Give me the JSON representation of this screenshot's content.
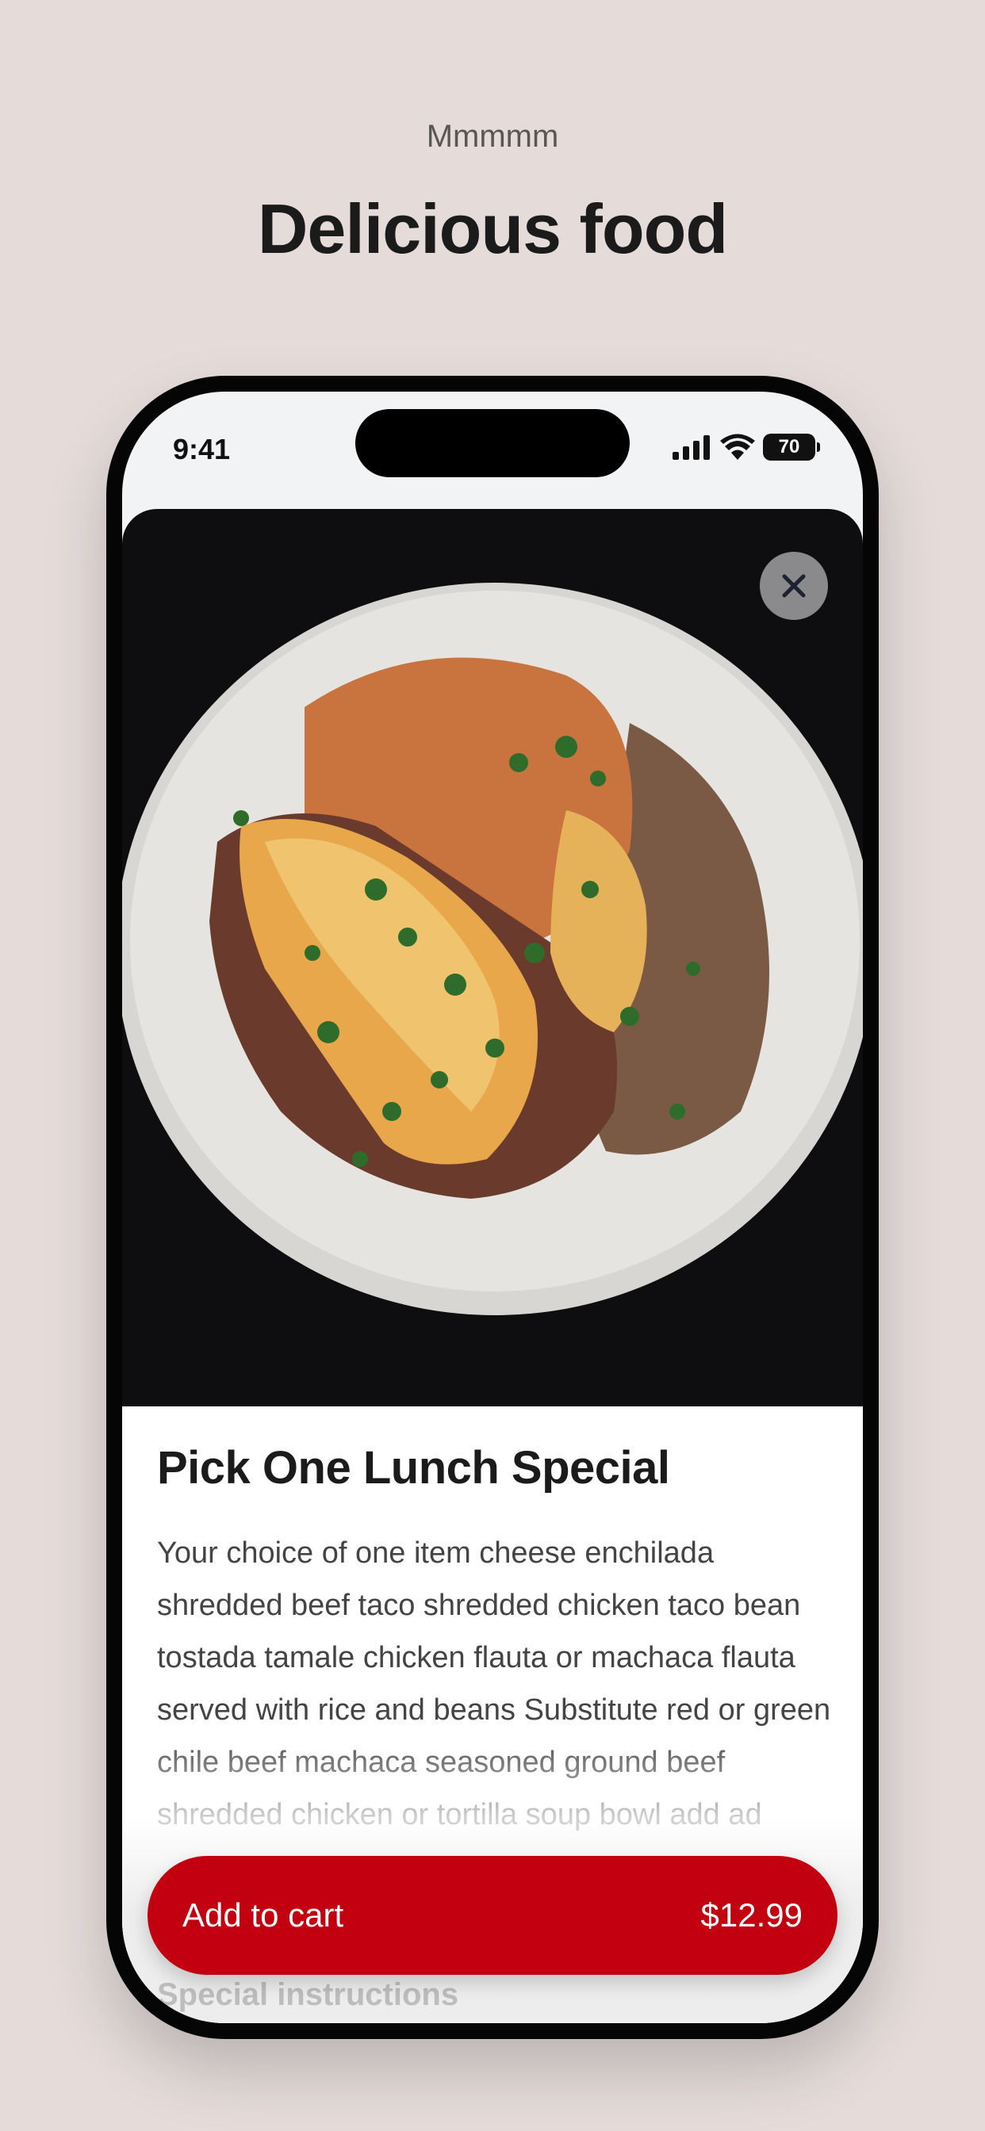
{
  "page": {
    "eyebrow": "Mmmmm",
    "headline": "Delicious food"
  },
  "status_bar": {
    "time": "9:41",
    "battery": "70"
  },
  "item": {
    "title": "Pick One Lunch Special",
    "description": "Your choice of one item cheese enchilada shredded beef taco shredded chicken taco bean tostada tamale chicken flauta or machaca flauta served with rice and beans Substitute red or green chile beef machaca seasoned ground beef shredded chicken or tortilla soup bowl add ad",
    "special_instructions": "Special instructions"
  },
  "cart_button": {
    "label": "Add to cart",
    "price": "$12.99"
  },
  "colors": {
    "background": "#e5dcda",
    "accent": "#c3000f",
    "hero_bg": "#0e0e10"
  },
  "icons": {
    "close": "close-icon",
    "signal": "cellular-signal-icon",
    "wifi": "wifi-icon",
    "battery": "battery-icon"
  }
}
